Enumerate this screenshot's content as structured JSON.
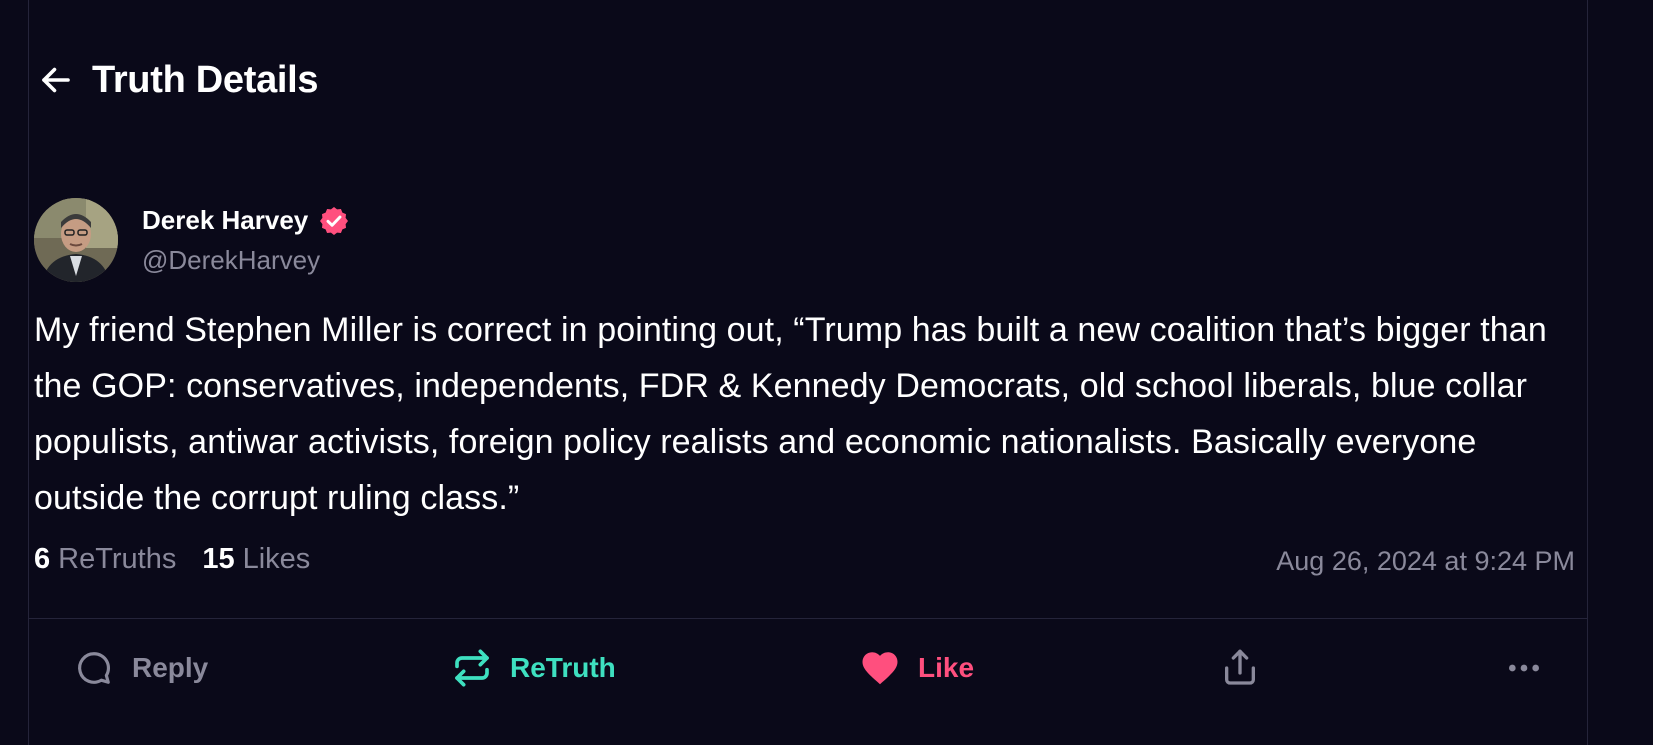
{
  "header": {
    "title": "Truth Details"
  },
  "post": {
    "author": {
      "display_name": "Derek Harvey",
      "handle": "@DerekHarvey",
      "verified": true
    },
    "text": "My friend Stephen Miller is correct in pointing out, “Trump has built a new coalition that’s bigger than the GOP: conservatives, independents, FDR & Kennedy Democrats, old school liberals, blue collar populists, antiwar activists, foreign policy realists and economic nationalists. Basically everyone outside the corrupt ruling class.”",
    "stats": {
      "retruths_count": "6",
      "retruths_label": "ReTruths",
      "likes_count": "15",
      "likes_label": "Likes"
    },
    "timestamp": "Aug 26, 2024 at 9:24 PM"
  },
  "actions": {
    "reply_label": "Reply",
    "retruth_label": "ReTruth",
    "like_label": "Like"
  },
  "colors": {
    "background": "#0a0919",
    "muted_text": "#8a899b",
    "retruth_green": "#3ee0c0",
    "like_pink": "#ff4f7e",
    "verified_pink": "#ff4f7e",
    "divider": "#25243a"
  },
  "icons": {
    "back": "arrow-left-icon",
    "verified": "verified-badge-icon",
    "reply": "speech-bubble-icon",
    "retruth": "repost-arrows-icon",
    "like": "heart-icon",
    "share": "share-upload-icon",
    "more": "more-horizontal-icon"
  }
}
